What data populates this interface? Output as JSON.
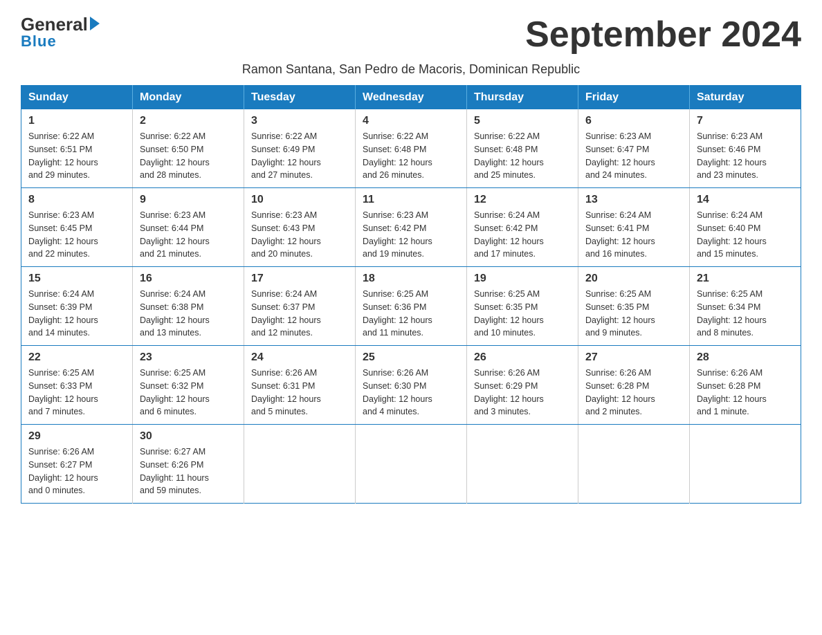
{
  "logo": {
    "general": "General",
    "triangle": "",
    "blue_line": "Blue"
  },
  "title": "September 2024",
  "subtitle": "Ramon Santana, San Pedro de Macoris, Dominican Republic",
  "days_header": [
    "Sunday",
    "Monday",
    "Tuesday",
    "Wednesday",
    "Thursday",
    "Friday",
    "Saturday"
  ],
  "weeks": [
    [
      {
        "day": "1",
        "sunrise": "6:22 AM",
        "sunset": "6:51 PM",
        "daylight": "12 hours and 29 minutes."
      },
      {
        "day": "2",
        "sunrise": "6:22 AM",
        "sunset": "6:50 PM",
        "daylight": "12 hours and 28 minutes."
      },
      {
        "day": "3",
        "sunrise": "6:22 AM",
        "sunset": "6:49 PM",
        "daylight": "12 hours and 27 minutes."
      },
      {
        "day": "4",
        "sunrise": "6:22 AM",
        "sunset": "6:48 PM",
        "daylight": "12 hours and 26 minutes."
      },
      {
        "day": "5",
        "sunrise": "6:22 AM",
        "sunset": "6:48 PM",
        "daylight": "12 hours and 25 minutes."
      },
      {
        "day": "6",
        "sunrise": "6:23 AM",
        "sunset": "6:47 PM",
        "daylight": "12 hours and 24 minutes."
      },
      {
        "day": "7",
        "sunrise": "6:23 AM",
        "sunset": "6:46 PM",
        "daylight": "12 hours and 23 minutes."
      }
    ],
    [
      {
        "day": "8",
        "sunrise": "6:23 AM",
        "sunset": "6:45 PM",
        "daylight": "12 hours and 22 minutes."
      },
      {
        "day": "9",
        "sunrise": "6:23 AM",
        "sunset": "6:44 PM",
        "daylight": "12 hours and 21 minutes."
      },
      {
        "day": "10",
        "sunrise": "6:23 AM",
        "sunset": "6:43 PM",
        "daylight": "12 hours and 20 minutes."
      },
      {
        "day": "11",
        "sunrise": "6:23 AM",
        "sunset": "6:42 PM",
        "daylight": "12 hours and 19 minutes."
      },
      {
        "day": "12",
        "sunrise": "6:24 AM",
        "sunset": "6:42 PM",
        "daylight": "12 hours and 17 minutes."
      },
      {
        "day": "13",
        "sunrise": "6:24 AM",
        "sunset": "6:41 PM",
        "daylight": "12 hours and 16 minutes."
      },
      {
        "day": "14",
        "sunrise": "6:24 AM",
        "sunset": "6:40 PM",
        "daylight": "12 hours and 15 minutes."
      }
    ],
    [
      {
        "day": "15",
        "sunrise": "6:24 AM",
        "sunset": "6:39 PM",
        "daylight": "12 hours and 14 minutes."
      },
      {
        "day": "16",
        "sunrise": "6:24 AM",
        "sunset": "6:38 PM",
        "daylight": "12 hours and 13 minutes."
      },
      {
        "day": "17",
        "sunrise": "6:24 AM",
        "sunset": "6:37 PM",
        "daylight": "12 hours and 12 minutes."
      },
      {
        "day": "18",
        "sunrise": "6:25 AM",
        "sunset": "6:36 PM",
        "daylight": "12 hours and 11 minutes."
      },
      {
        "day": "19",
        "sunrise": "6:25 AM",
        "sunset": "6:35 PM",
        "daylight": "12 hours and 10 minutes."
      },
      {
        "day": "20",
        "sunrise": "6:25 AM",
        "sunset": "6:35 PM",
        "daylight": "12 hours and 9 minutes."
      },
      {
        "day": "21",
        "sunrise": "6:25 AM",
        "sunset": "6:34 PM",
        "daylight": "12 hours and 8 minutes."
      }
    ],
    [
      {
        "day": "22",
        "sunrise": "6:25 AM",
        "sunset": "6:33 PM",
        "daylight": "12 hours and 7 minutes."
      },
      {
        "day": "23",
        "sunrise": "6:25 AM",
        "sunset": "6:32 PM",
        "daylight": "12 hours and 6 minutes."
      },
      {
        "day": "24",
        "sunrise": "6:26 AM",
        "sunset": "6:31 PM",
        "daylight": "12 hours and 5 minutes."
      },
      {
        "day": "25",
        "sunrise": "6:26 AM",
        "sunset": "6:30 PM",
        "daylight": "12 hours and 4 minutes."
      },
      {
        "day": "26",
        "sunrise": "6:26 AM",
        "sunset": "6:29 PM",
        "daylight": "12 hours and 3 minutes."
      },
      {
        "day": "27",
        "sunrise": "6:26 AM",
        "sunset": "6:28 PM",
        "daylight": "12 hours and 2 minutes."
      },
      {
        "day": "28",
        "sunrise": "6:26 AM",
        "sunset": "6:28 PM",
        "daylight": "12 hours and 1 minute."
      }
    ],
    [
      {
        "day": "29",
        "sunrise": "6:26 AM",
        "sunset": "6:27 PM",
        "daylight": "12 hours and 0 minutes."
      },
      {
        "day": "30",
        "sunrise": "6:27 AM",
        "sunset": "6:26 PM",
        "daylight": "11 hours and 59 minutes."
      },
      null,
      null,
      null,
      null,
      null
    ]
  ],
  "labels": {
    "sunrise": "Sunrise:",
    "sunset": "Sunset:",
    "daylight": "Daylight:"
  }
}
